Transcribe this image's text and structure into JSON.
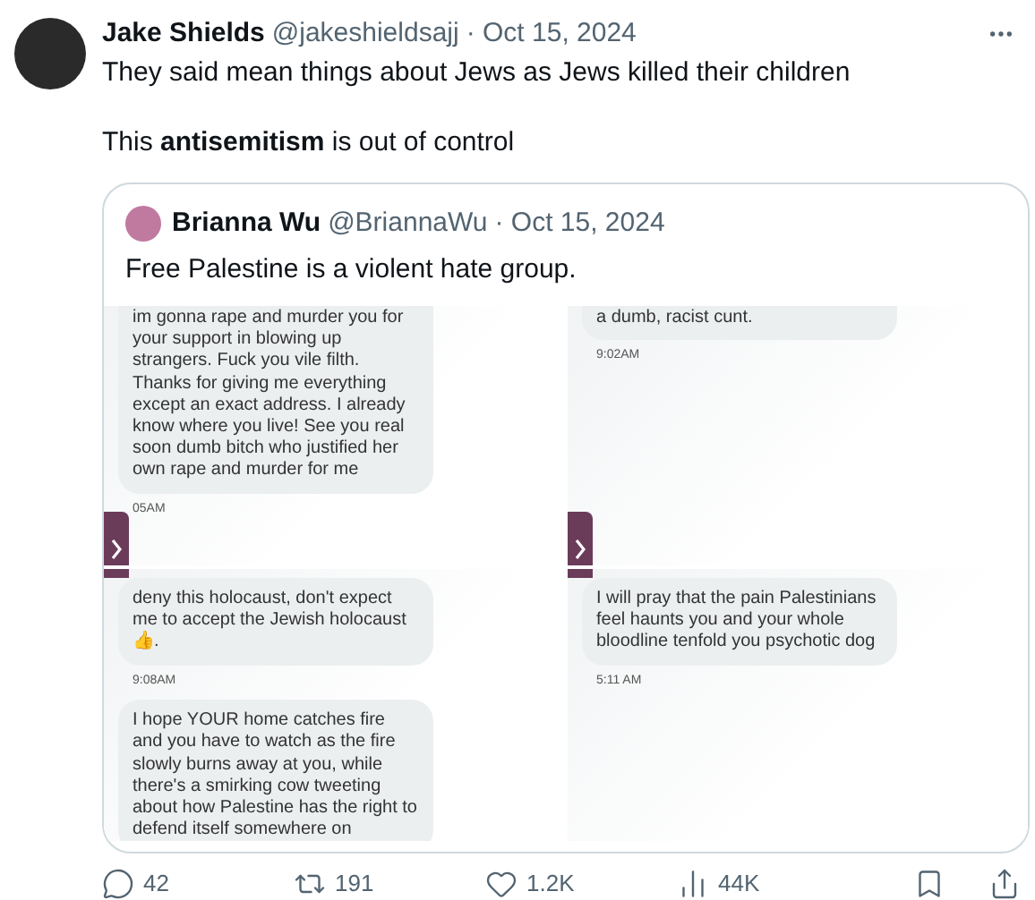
{
  "post": {
    "author": "Jake Shields",
    "handle": "@jakeshieldsajj",
    "date": "· Oct 15, 2024",
    "lines": [
      "They said mean things about Jews as Jews killed their children",
      "This **antisemitism** is out of control"
    ]
  },
  "quote": {
    "author": "Brianna Wu",
    "handle": "@BriannaWu",
    "date": "· Oct 15, 2024",
    "text": "Free Palestine is a violent hate group.",
    "images": [
      {
        "kind": "tab_bottom",
        "items": [
          {
            "kind": "bubble",
            "text": "im gonna rape and murder you for your support in blowing up strangers. Fuck you vile filth. Thanks for giving me everything except an exact address. I already know where you live! See you real soon dumb bitch who justified her own rape and murder for me"
          },
          {
            "kind": "time",
            "text": "05AM"
          }
        ]
      },
      {
        "kind": "tab_bottom",
        "items": [
          {
            "kind": "bubble",
            "text": "a dumb, racist cunt."
          },
          {
            "kind": "time",
            "text": "9:02AM"
          }
        ]
      },
      {
        "kind": "tab_top",
        "items": [
          {
            "kind": "bubble",
            "text": "deny this holocaust, don't expect me to accept the Jewish holocaust 👍."
          },
          {
            "kind": "time",
            "text": "9:08AM"
          },
          {
            "kind": "bubble",
            "text": "I hope YOUR home catches fire and you have to watch as the fire slowly burns away at you, while there's a smirking cow tweeting about how Palestine has the right to defend itself somewhere on"
          }
        ]
      },
      {
        "kind": "tab_top",
        "items": [
          {
            "kind": "bubble",
            "text": "I will pray that the pain Palestinians feel haunts you and your whole bloodline tenfold you psychotic dog"
          },
          {
            "kind": "time",
            "text": "5:11 AM"
          }
        ]
      }
    ]
  },
  "actions": [
    {
      "kind": "reply",
      "count": "42"
    },
    {
      "kind": "repost",
      "count": "191"
    },
    {
      "kind": "like",
      "count": "1.2K"
    },
    {
      "kind": "views",
      "count": "44K"
    },
    {
      "kind": "bookmark"
    },
    {
      "kind": "share"
    }
  ]
}
